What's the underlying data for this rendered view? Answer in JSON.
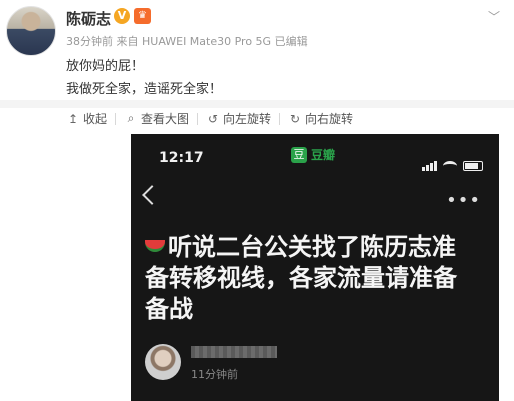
{
  "post": {
    "author": "陈砺志",
    "verified_badge": "V",
    "member_badge": "♛",
    "meta": "38分钟前 来自 HUAWEI Mate30 Pro 5G 已编辑",
    "lines": [
      "放你妈的屁！",
      "我做死全家，造谣死全家！"
    ]
  },
  "toolbar": {
    "collapse": "收起",
    "view_large": "查看大图",
    "rotate_left": "向左旋转",
    "rotate_right": "向右旋转"
  },
  "screenshot": {
    "time": "12:17",
    "app_name": "豆瓣",
    "app_icon_text": "豆",
    "more": "•••",
    "headline": [
      "听说二台公关找了陈历志准",
      "备转移视线，各家流量请准备",
      "备战"
    ],
    "poster_time": "11分钟前"
  },
  "icons": {
    "collapse": "up-arrow",
    "view_large": "magnifier",
    "rotate_left": "rotate-ccw",
    "rotate_right": "rotate-cw",
    "chevron": "chevron-down"
  },
  "colors": {
    "accent": "#f5a623",
    "douban_green": "#2aa24a",
    "phone_bg": "#161616"
  }
}
